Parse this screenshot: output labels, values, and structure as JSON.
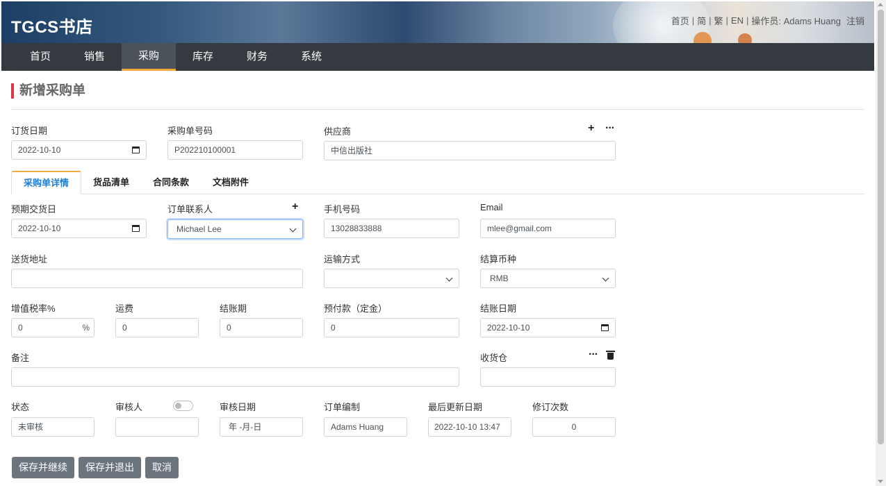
{
  "header": {
    "brand": "TGCS书店",
    "links": {
      "home": "首页",
      "simplified": "简",
      "traditional": "繁",
      "english": "EN",
      "operator": "操作员: Adams Huang",
      "logout": "注销"
    }
  },
  "nav": {
    "items": [
      "首页",
      "销售",
      "采购",
      "库存",
      "财务",
      "系统"
    ],
    "active": "采购"
  },
  "page_title": "新增采购单",
  "order": {
    "order_date_label": "订货日期",
    "order_date": "2022-10-10",
    "po_number_label": "采购单号码",
    "po_number": "P202210100001",
    "supplier_label": "供应商",
    "supplier": "中信出版社"
  },
  "tabs": [
    "采购单详情",
    "货品清单",
    "合同条款",
    "文档附件"
  ],
  "details": {
    "expected_date_label": "预期交货日",
    "expected_date": "2022-10-10",
    "contact_label": "订单联系人",
    "contact": "Michael Lee",
    "mobile_label": "手机号码",
    "mobile": "13028833888",
    "email_label": "Email",
    "email": "mlee@gmail.com",
    "address_label": "送货地址",
    "address": "",
    "shipping_label": "运输方式",
    "shipping": "",
    "currency_label": "结算币种",
    "currency": "RMB",
    "vat_label": "增值税率%",
    "vat": "0",
    "vat_suffix": "%",
    "freight_label": "运费",
    "freight": "0",
    "term_label": "结账期",
    "term": "0",
    "prepay_label": "预付款（定金）",
    "prepay": "0",
    "settle_date_label": "结账日期",
    "settle_date": "2022-10-10",
    "remark_label": "备注",
    "remark": "",
    "warehouse_label": "收货仓",
    "warehouse": "",
    "status_label": "状态",
    "status": "未审核",
    "reviewer_label": "审核人",
    "reviewer": "",
    "review_date_label": "审核日期",
    "review_date": "年 -月-日",
    "creator_label": "订单编制",
    "creator": "Adams Huang",
    "updated_label": "最后更新日期",
    "updated": "2022-10-10 13:47",
    "revisions_label": "修订次数",
    "revisions": "0"
  },
  "buttons": {
    "save_continue": "保存并继续",
    "save_exit": "保存并退出",
    "cancel": "取消"
  },
  "colors": {
    "nav_bg": "#343a40",
    "accent": "#f0a93b",
    "title_bar": "#dc3545",
    "tab_active": "#1e7fd0",
    "button": "#6c757d"
  }
}
